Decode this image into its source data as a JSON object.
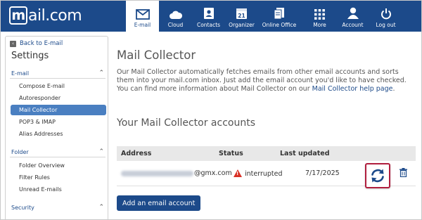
{
  "brand": {
    "logo_mark": "m",
    "logo_text": "ail.com"
  },
  "nav": [
    {
      "label": "E-mail",
      "icon": "mail-icon",
      "active": true
    },
    {
      "label": "Cloud",
      "icon": "cloud-icon"
    },
    {
      "label": "Contacts",
      "icon": "contacts-icon"
    },
    {
      "label": "Organizer",
      "icon": "calendar-icon",
      "badge": "21"
    },
    {
      "label": "Online Office",
      "icon": "office-icon"
    },
    {
      "label": "More",
      "icon": "grid-icon"
    },
    {
      "label": "Account",
      "icon": "account-icon"
    },
    {
      "label": "Log out",
      "icon": "power-icon"
    }
  ],
  "sidebar": {
    "back_label": "Back to E-mail",
    "title": "Settings",
    "sections": [
      {
        "label": "E-mail",
        "items": [
          "Compose E-mail",
          "Autoresponder",
          "Mail Collector",
          "POP3 & IMAP",
          "Alias Addresses"
        ]
      },
      {
        "label": "Folder",
        "items": [
          "Folder Overview",
          "Filter Rules",
          "Unread E-mails"
        ]
      },
      {
        "label": "Security",
        "items": []
      }
    ],
    "active_item": "Mail Collector"
  },
  "main": {
    "title": "Mail Collector",
    "description": "Our Mail Collector automatically fetches emails from other email accounts and sorts them into your mail.com inbox. Just add the email account you'd like to have checked. You can find more information about Mail Collector on our ",
    "help_link": "Mail Collector help page",
    "desc_end": ".",
    "accounts_title": "Your Mail Collector accounts",
    "table": {
      "headers": {
        "address": "Address",
        "status": "Status",
        "updated": "Last updated"
      },
      "rows": [
        {
          "address_domain": "@gmx.com",
          "status": "interrupted",
          "updated": "7/17/2025"
        }
      ]
    },
    "add_button": "Add an email account"
  },
  "colors": {
    "brand_blue": "#1c4a8a",
    "active_blue": "#4a7fc1",
    "highlight_red": "#b01e3e",
    "warning_red": "#d93025"
  }
}
